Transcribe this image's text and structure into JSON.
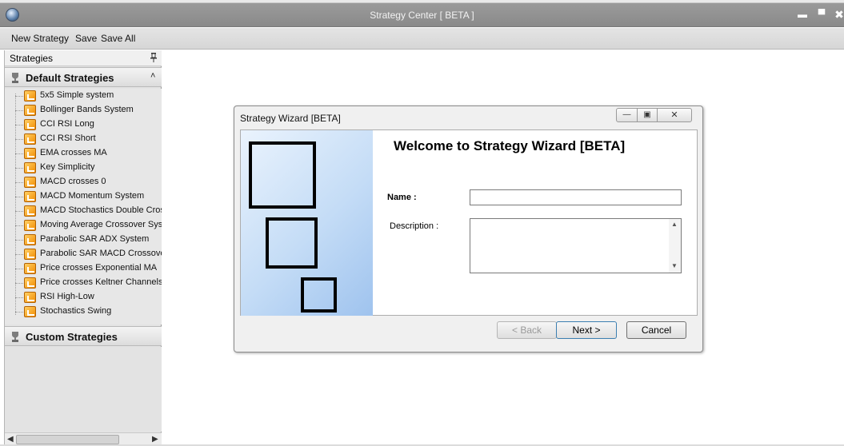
{
  "window": {
    "title": "Strategy Center [ BETA ]",
    "minimize_glyph": "▬",
    "maximize_glyph": "▀",
    "close_glyph": "✖"
  },
  "menu": {
    "items": [
      "New Strategy",
      "Save",
      "Save All"
    ]
  },
  "panel": {
    "title": "Strategies",
    "default_group": "Default Strategies",
    "custom_group": "Custom Strategies",
    "strategies": [
      "5x5 Simple system",
      "Bollinger Bands System",
      "CCI RSI Long",
      "CCI RSI Short",
      "EMA crosses MA",
      "Key Simplicity",
      "MACD crosses 0",
      "MACD Momentum System",
      "MACD Stochastics Double Cross",
      "Moving Average Crossover System",
      "Parabolic SAR ADX System",
      "Parabolic SAR MACD Crossover",
      "Price crosses Exponential MA",
      "Price crosses Keltner Channels",
      "RSI High-Low",
      "Stochastics Swing"
    ]
  },
  "dialog": {
    "title": "Strategy Wizard [BETA]",
    "heading": "Welcome to Strategy Wizard [BETA]",
    "name_label": "Name :",
    "name_value": "",
    "description_label": "Description :",
    "description_value": "",
    "buttons": {
      "back": "< Back",
      "next": "Next >",
      "cancel": "Cancel"
    },
    "title_buttons": {
      "minimize": "—",
      "maximize": "▣",
      "close": "✕"
    }
  },
  "colors": {
    "title_bar": "#8f8f8f",
    "panel_bg": "#e3e3e3",
    "wizard_art_light": "#eaf3fd",
    "wizard_art_dark": "#9fc3ee",
    "strategy_icon": "#f28c00"
  }
}
